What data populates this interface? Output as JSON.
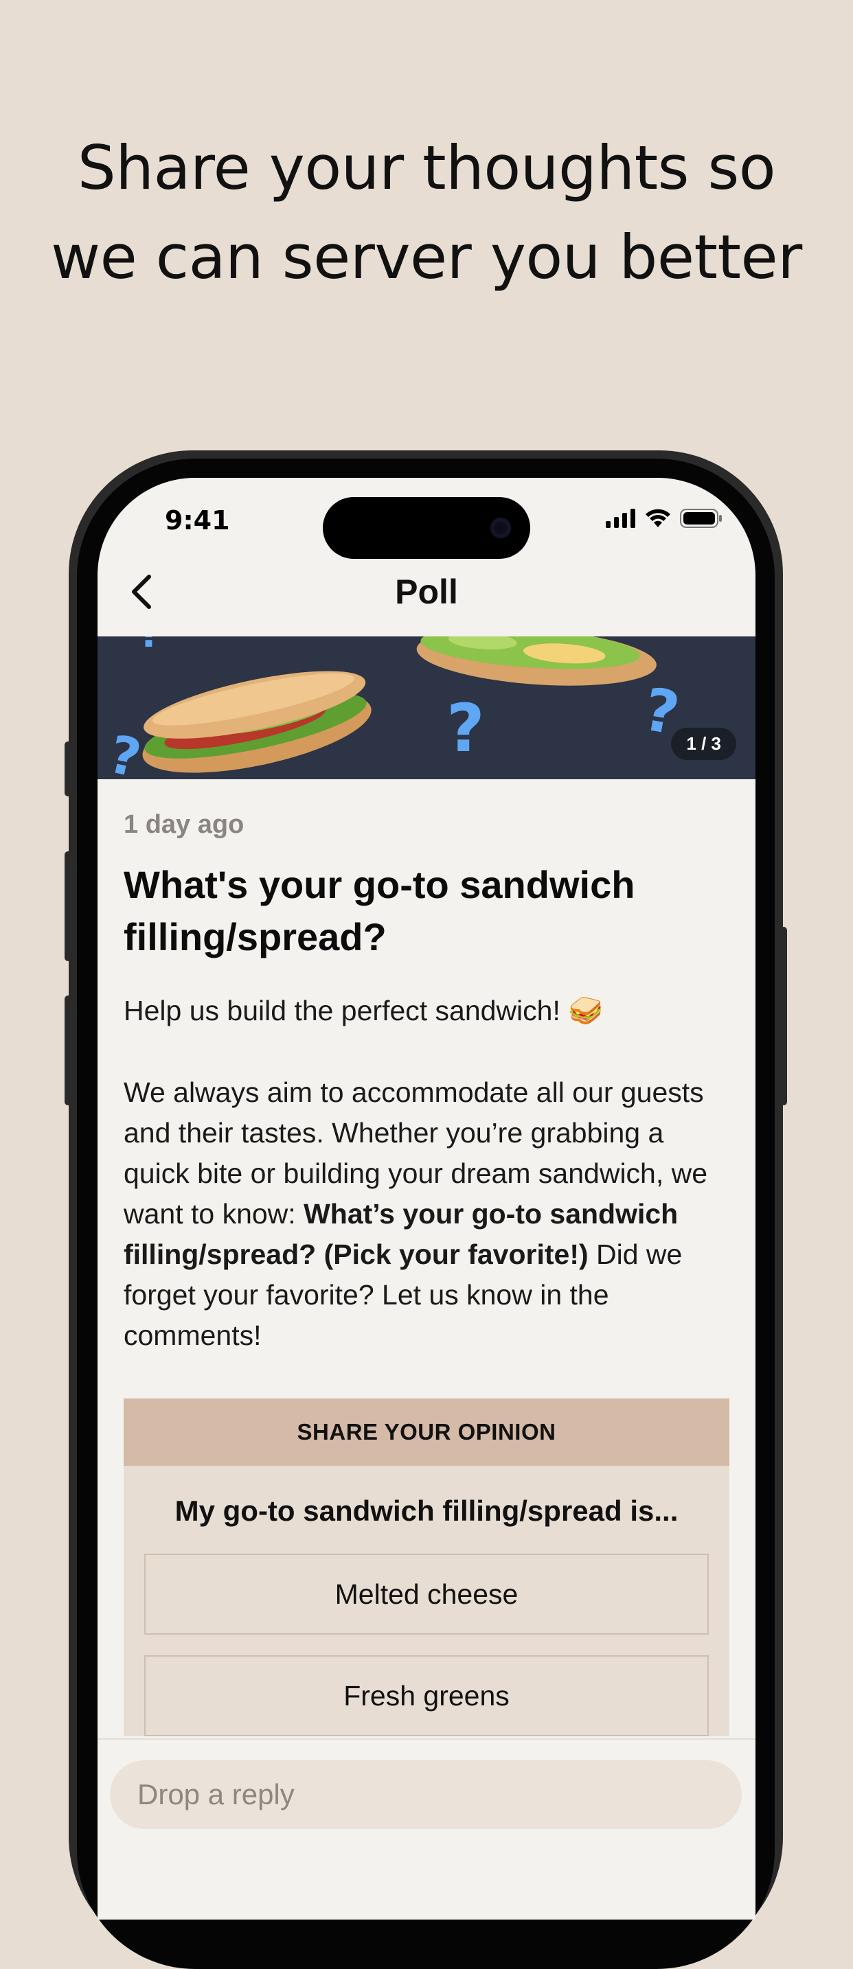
{
  "marketing": {
    "headline_line1": "Share your thoughts so",
    "headline_line2": "we can server you better"
  },
  "status_bar": {
    "time": "9:41",
    "icons": [
      "signal-icon",
      "wifi-icon",
      "battery-icon"
    ]
  },
  "nav": {
    "back_icon": "chevron-left-icon",
    "title": "Poll"
  },
  "banner": {
    "image_description_icons": [
      "sandwich-image",
      "question-mark-icon"
    ],
    "question_mark": "?",
    "counter": "1 / 3"
  },
  "post": {
    "time_ago": "1 day ago",
    "title": "What's your go-to sandwich filling/spread?",
    "intro": "Help us build the perfect sandwich! 🥪",
    "body_part1": "We always aim to accommodate all our guests and their tastes. Whether you’re grabbing a quick bite or building your dream sandwich, we want to know: ",
    "body_bold": "What’s your go-to sandwich filling/spread? (Pick your favorite!)",
    "body_part2": " Did we forget your favorite? Let us know in the comments!"
  },
  "poll": {
    "header": "SHARE YOUR OPINION",
    "question": "My go-to sandwich filling/spread is...",
    "options": [
      {
        "label": "Melted cheese"
      },
      {
        "label": "Fresh greens"
      }
    ]
  },
  "reply": {
    "placeholder": "Drop a reply"
  },
  "colors": {
    "page_bg": "#e8ddd3",
    "screen_bg": "#f4f2ee",
    "banner_bg": "#2c3445",
    "question_mark": "#5fa6f4",
    "poll_header": "#d4baa7"
  }
}
